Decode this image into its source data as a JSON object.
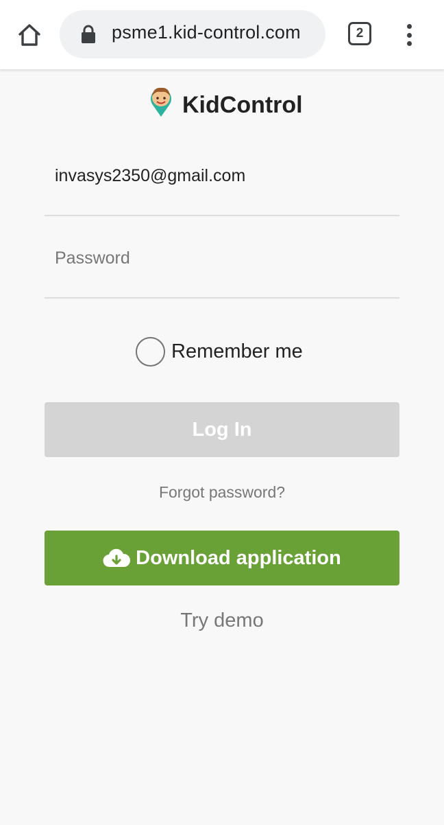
{
  "browser": {
    "url": "psme1.kid-control.com",
    "tab_count": "2",
    "icons": [
      "home-icon",
      "lock-icon",
      "tabs-icon",
      "more-vert-icon"
    ]
  },
  "brand": {
    "name": "KidControl",
    "logo_icon": "kid-location-pin-icon"
  },
  "login_form": {
    "email_value": "invasys2350@gmail.com",
    "password_placeholder": "Password",
    "remember_label": "Remember me",
    "login_label": "Log In",
    "forgot_label": "Forgot password?"
  },
  "download": {
    "label": "Download application",
    "icon": "cloud-download-icon"
  },
  "demo": {
    "label": "Try demo"
  },
  "colors": {
    "accent_green": "#6aa136",
    "disabled_button": "#d4d4d4",
    "page_background": "#f8f8f8"
  }
}
